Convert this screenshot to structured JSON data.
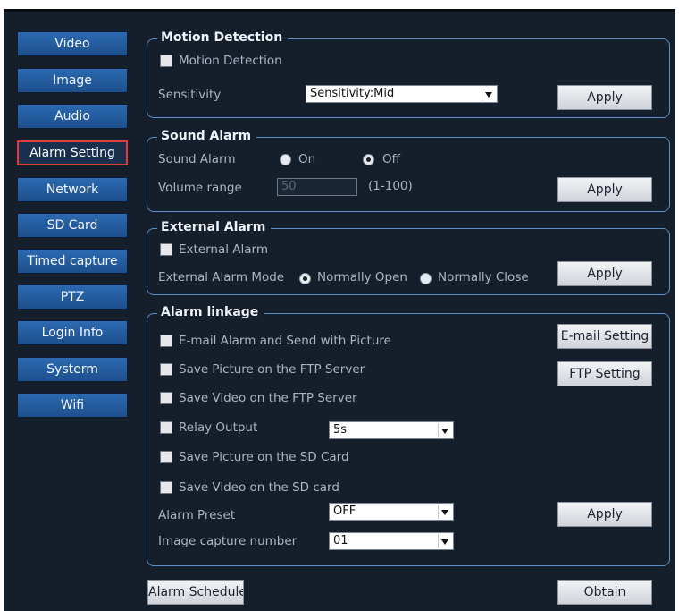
{
  "sidebar": {
    "items": [
      {
        "label": "Video"
      },
      {
        "label": "Image"
      },
      {
        "label": "Audio"
      },
      {
        "label": "Alarm Setting"
      },
      {
        "label": "Network"
      },
      {
        "label": "SD Card"
      },
      {
        "label": "Timed capture"
      },
      {
        "label": "PTZ"
      },
      {
        "label": "Login Info"
      },
      {
        "label": "Systerm"
      },
      {
        "label": "Wifi"
      }
    ],
    "active_index": 3
  },
  "motion": {
    "legend": "Motion Detection",
    "checkbox_label": "Motion Detection",
    "sensitivity_label": "Sensitivity",
    "sensitivity_value": "Sensitivity:Mid",
    "apply": "Apply"
  },
  "sound": {
    "legend": "Sound Alarm",
    "label": "Sound Alarm",
    "on": "On",
    "off": "Off",
    "selected": "Off",
    "volume_label": "Volume range",
    "volume_value": "50",
    "volume_hint": "(1-100)",
    "apply": "Apply"
  },
  "external": {
    "legend": "External Alarm",
    "checkbox_label": "External Alarm",
    "mode_label": "External Alarm Mode",
    "normally_open": "Normally Open",
    "normally_close": "Normally Close",
    "selected": "Normally Open",
    "apply": "Apply"
  },
  "linkage": {
    "legend": "Alarm linkage",
    "email": "E-mail Alarm and Send with Picture",
    "ftp_picture": "Save Picture on the FTP Server",
    "ftp_video": "Save Video on the FTP Server",
    "relay": "Relay Output",
    "relay_value": "5s",
    "sd_picture": "Save Picture on the SD Card",
    "sd_video": "Save Video on the SD card",
    "preset_label": "Alarm Preset",
    "preset_value": "OFF",
    "capture_label": "Image capture number",
    "capture_value": "01",
    "email_setting": "E-mail Setting",
    "ftp_setting": "FTP Setting",
    "apply": "Apply"
  },
  "footer": {
    "schedule": "Alarm Schedule",
    "obtain": "Obtain"
  }
}
